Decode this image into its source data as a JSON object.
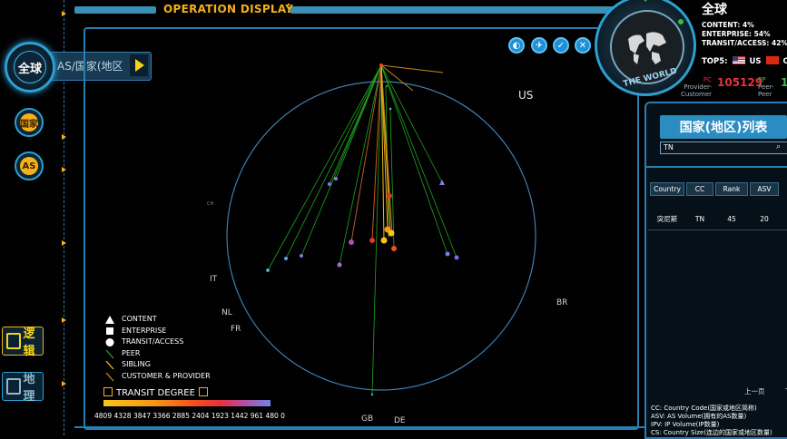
{
  "header": {
    "title": "OPERATION DISPLAY"
  },
  "nav": {
    "global_label": "全球",
    "scope_label": "AS/国家(地区",
    "country_label": "国家",
    "as_label": "AS",
    "logic_label": "逻辑",
    "geo_label": "地理"
  },
  "scope": {
    "title": "全球",
    "content": "CONTENT:  4%",
    "enterprise": "ENTERPRISE:  54%",
    "transit": "TRANSIT/ACCESS:  42%",
    "tops_label": "TOP5:",
    "top1": "US",
    "top2": "CN",
    "world_label": "THE WORLD",
    "provider_customer_label_a": "PC",
    "provider_customer_label_b": "Provider-",
    "provider_customer_label_c": "Customer",
    "provider_customer_value": "105129",
    "peer_label_a": "PP",
    "peer_label_b": "Peer-",
    "peer_label_c": "Peer",
    "peer_value": "1"
  },
  "map": {
    "labels": {
      "us": "US",
      "br": "BR",
      "it": "IT",
      "nl": "NL",
      "fr": "FR",
      "gb": "GB",
      "de": "DE",
      "ch": "CH"
    },
    "colors": {
      "ring": "#3e7fb0",
      "peer": "#1fa51f",
      "customer": "#c8871a",
      "sibling": "#e1c41a"
    }
  },
  "legend": {
    "content": "CONTENT",
    "enterprise": "ENTERPRISE",
    "transit": "TRANSIT/ACCESS",
    "peer": "PEER",
    "sibling": "SIBLING",
    "customer": "CUSTOMER & PROVIDER",
    "degree_title": "TRANSIT DEGREE",
    "degree_ticks": "4809 4328 3847 3366 2885 2404 1923 1442 961    480    0"
  },
  "panel": {
    "title": "国家(地区)列表",
    "search_value": "TN",
    "columns": [
      "Country",
      "CC",
      "Rank",
      "ASV"
    ],
    "rows": [
      {
        "country": "突尼斯",
        "cc": "TN",
        "rank": "45",
        "asv": "20"
      }
    ],
    "prev_page": "上一页",
    "next_page": "下",
    "notes": [
      "CC:  Country Code(国家或地区简称)",
      "ASV: AS Volume(拥有的AS数量)",
      "IPV: IP Volume(IP数量)",
      "CS: Country Size(连边的国家或地区数量)"
    ]
  }
}
